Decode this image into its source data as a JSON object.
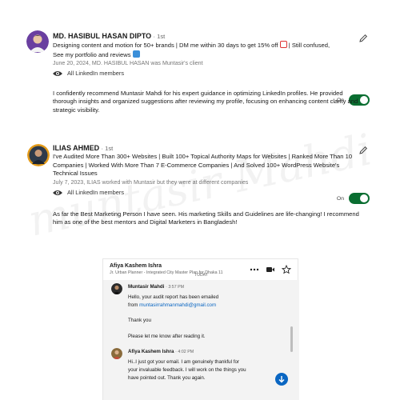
{
  "recommendations": [
    {
      "name": "MD. HASIBUL HASAN DIPTO",
      "degree": "· 1st",
      "headline_line1": "Designing content and motion for 50+ brands | DM me within 30 days to get 15% off",
      "headline_line1_tail": " | Still confused,",
      "headline_line2": "See my portfolio and reviews",
      "meta": "June 20, 2024, MD. HASIBUL HASAN was Muntasir's client",
      "visibility": "All LinkedIn members",
      "toggle_label": "On",
      "body": "I confidently recommend Muntasir Mahdi for his expert guidance in optimizing LinkedIn profiles. He provided thorough insights and organized suggestions after reviewing my profile, focusing on enhancing content clarity and strategic visibility."
    },
    {
      "name": "ILIAS AHMED",
      "degree": "· 1st",
      "headline": "I've Audited More Than 300+ Websites | Built 100+ Topical Authority Maps for Websites | Ranked More Than 10 Companies | Worked With More Than 7 E-Commerce Companies | And Solved 100+ WordPress Website's Technical Issues",
      "meta": "July 7, 2023, ILIAS worked with Muntasir but they were at different companies",
      "visibility": "All LinkedIn members",
      "toggle_label": "On",
      "body": "As far the Best Marketing Person I have seen. His marketing Skills and Guidelines are life-changing! I recommend him as one of the best mentors and Digital Marketers in Bangladesh!"
    }
  ],
  "chat": {
    "contact_name": "Afiya Kashem Ishra",
    "contact_title": "Jr. Urban Planner - Integrated City Master Plan for Dhaka 11",
    "day_divider": "TODAY",
    "messages": [
      {
        "sender": "Muntasir Mahdi",
        "time": "· 3:57 PM",
        "line1": "Hello, your audit report has been emailed",
        "line2_prefix": "from ",
        "line2_link": "muntasirrahmanmahdi@gmail.com",
        "line3": "Thank you",
        "line4": "Please let me know after reading it."
      },
      {
        "sender": "Afiya Kashem Ishra",
        "time": "· 4:02 PM",
        "line1": "Hi..I just got your email. I am genuinely thankful for",
        "line2": "your invaluable feedback. I will work on the things you",
        "line3": "have pointed out. Thank you again."
      }
    ]
  },
  "icons": {
    "pencil": "pencil-icon",
    "eye": "eye-icon",
    "more": "more-options-icon",
    "video": "video-call-icon",
    "star": "star-icon",
    "down": "arrow-down-icon",
    "gift": "gift-emoji-icon",
    "arrow_box": "arrow-down-box-emoji-icon"
  },
  "colors": {
    "toggle_on": "#0a6e31",
    "link": "#0a66c2",
    "chat_bg": "#f3f3f3"
  }
}
